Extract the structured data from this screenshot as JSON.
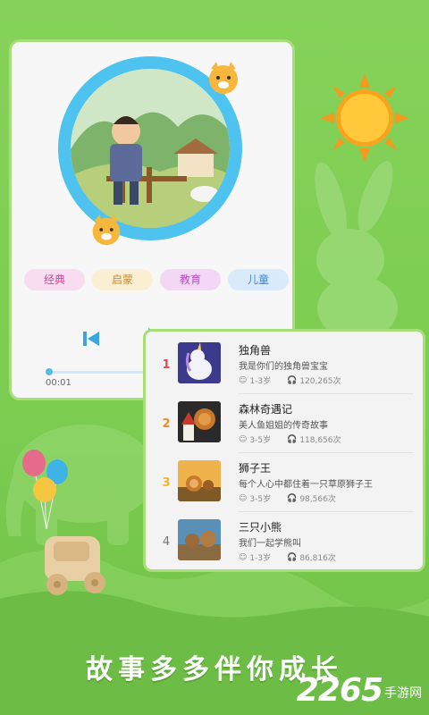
{
  "colors": {
    "bg": "#7bcc50",
    "ring": "#4ec3f0",
    "accent": "#56bbe9",
    "card_border": "#a6de7a"
  },
  "player": {
    "tags": [
      "经典",
      "启蒙",
      "教育",
      "儿童"
    ],
    "controls": {
      "prev_icon": "skip-previous-icon",
      "play_icon": "play-icon",
      "next_icon": "skip-next-icon"
    },
    "elapsed": "00:01",
    "progress": 0.02
  },
  "list": {
    "items": [
      {
        "rank": "1",
        "title": "独角兽",
        "desc": "我是你们的独角兽宝宝",
        "age": "1-3岁",
        "plays": "120,265次",
        "rank_color": "#e8435a"
      },
      {
        "rank": "2",
        "title": "森林奇遇记",
        "desc": "美人鱼姐姐的传奇故事",
        "age": "3-5岁",
        "plays": "118,656次",
        "rank_color": "#f08b2c"
      },
      {
        "rank": "3",
        "title": "狮子王",
        "desc": "每个人心中都住着一只草原狮子王",
        "age": "3-5岁",
        "plays": "98,566次",
        "rank_color": "#f3b41e"
      },
      {
        "rank": "4",
        "title": "三只小熊",
        "desc": "我们一起学熊叫",
        "age": "1-3岁",
        "plays": "86,816次",
        "rank_color": "#777777"
      }
    ]
  },
  "slogan": "故事多多伴你成长",
  "watermark": {
    "number": "2265",
    "text": "手游网"
  }
}
